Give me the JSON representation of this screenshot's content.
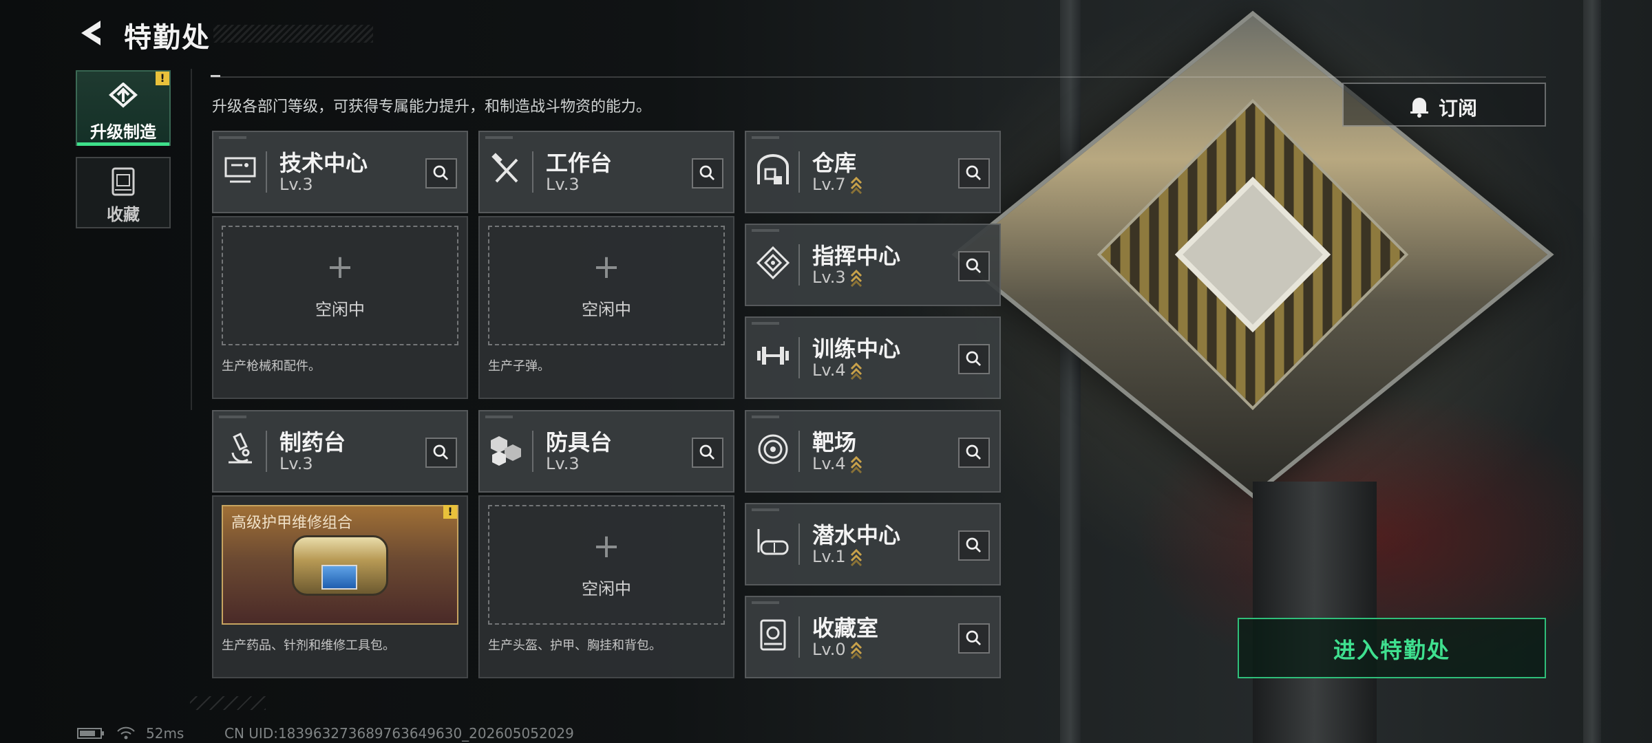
{
  "header": {
    "title": "特勤处",
    "back_icon": "back-arrow-icon"
  },
  "subtitle": "升级各部门等级，可获得专属能力提升，和制造战斗物资的能力。",
  "tabs": [
    {
      "label": "升级制造",
      "icon": "upgrade-craft-icon",
      "active": true,
      "alert": "!"
    },
    {
      "label": "收藏",
      "icon": "collection-icon",
      "active": false
    }
  ],
  "departments": {
    "tech_center": {
      "name": "技术中心",
      "level": "Lv.3",
      "desc": "生产枪械和配件。",
      "slot_status": "空闲中"
    },
    "workbench": {
      "name": "工作台",
      "level": "Lv.3",
      "desc": "生产子弹。",
      "slot_status": "空闲中"
    },
    "pharmacy": {
      "name": "制药台",
      "level": "Lv.3",
      "desc": "生产药品、针剂和维修工具包。",
      "craft_item": "高级护甲维修组合",
      "alert": "!"
    },
    "armor_bench": {
      "name": "防具台",
      "level": "Lv.3",
      "desc": "生产头盔、护甲、胸挂和背包。",
      "slot_status": "空闲中"
    },
    "warehouse": {
      "name": "仓库",
      "level": "Lv.7"
    },
    "command_center": {
      "name": "指挥中心",
      "level": "Lv.3"
    },
    "training_center": {
      "name": "训练中心",
      "level": "Lv.4"
    },
    "shooting_range": {
      "name": "靶场",
      "level": "Lv.4"
    },
    "diving_center": {
      "name": "潜水中心",
      "level": "Lv.1"
    },
    "collection_room": {
      "name": "收藏室",
      "level": "Lv.0"
    }
  },
  "subscribe_button": {
    "label": "订阅"
  },
  "enter_button": {
    "label": "进入特勤处"
  },
  "footer": {
    "ping": "52ms",
    "uid": "CN UID:18396327368976364​9630_202605052029"
  },
  "colors": {
    "accent_green": "#3fe08f",
    "warning_yellow": "#e9c13b",
    "upgrade_gold": "#c9a24a"
  }
}
